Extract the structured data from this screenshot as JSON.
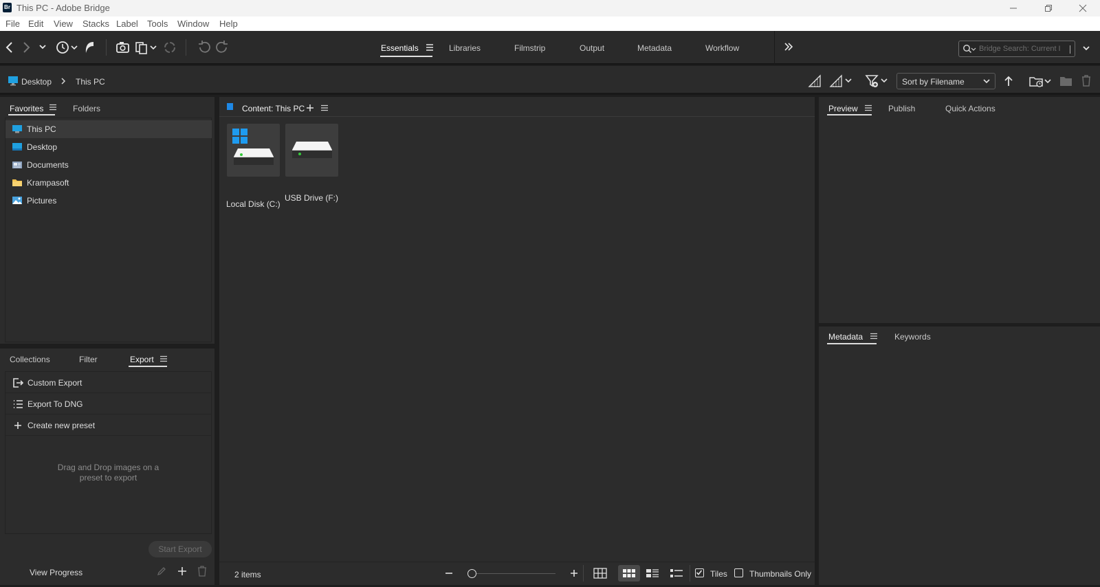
{
  "window": {
    "title": "This PC - Adobe Bridge",
    "app_badge": "Br",
    "controls": [
      "minimize-icon",
      "restore-icon",
      "close-icon"
    ]
  },
  "menu": [
    "File",
    "Edit",
    "View",
    "Stacks",
    "Label",
    "Tools",
    "Window",
    "Help"
  ],
  "workspaces": {
    "tabs": [
      "Essentials",
      "Libraries",
      "Filmstrip",
      "Output",
      "Metadata",
      "Workflow"
    ],
    "active": "Essentials",
    "overflow_icon": "double-chevron-right-icon"
  },
  "search": {
    "placeholder": "Bridge Search: Current I"
  },
  "pathbar": {
    "crumbs": [
      "Desktop",
      "This PC"
    ],
    "sort_label": "Sort by Filename"
  },
  "left_top": {
    "tabs": [
      "Favorites",
      "Folders"
    ],
    "active": "Favorites",
    "items": [
      {
        "label": "This PC",
        "icon": "monitor-icon",
        "selected": true
      },
      {
        "label": "Desktop",
        "icon": "desktop-icon",
        "selected": false
      },
      {
        "label": "Documents",
        "icon": "documents-icon",
        "selected": false
      },
      {
        "label": "Krampasoft",
        "icon": "folder-icon",
        "selected": false
      },
      {
        "label": "Pictures",
        "icon": "pictures-icon",
        "selected": false
      }
    ]
  },
  "left_bottom": {
    "tabs": [
      "Collections",
      "Filter",
      "Export"
    ],
    "active": "Export",
    "items": [
      {
        "label": "Custom Export",
        "icon": "export-icon"
      },
      {
        "label": "Export To DNG",
        "icon": "list-icon"
      },
      {
        "label": "Create new preset",
        "icon": "plus-icon"
      }
    ],
    "drop_hint": [
      "Drag and Drop images on a",
      "preset to export"
    ],
    "start_export": "Start Export",
    "view_progress": "View Progress"
  },
  "content": {
    "title": "Content: This PC",
    "items": [
      {
        "label": "Local Disk (C:)",
        "icon": "system-drive-icon"
      },
      {
        "label": "USB Drive (F:)",
        "icon": "drive-icon"
      }
    ],
    "count": "2 items",
    "tiles_label": "Tiles",
    "tiles_checked": true,
    "thumbs_only_label": "Thumbnails Only",
    "thumbs_only_checked": false
  },
  "right_top": {
    "tabs": [
      "Preview",
      "Publish",
      "Quick Actions"
    ],
    "active": "Preview"
  },
  "right_bottom": {
    "tabs": [
      "Metadata",
      "Keywords"
    ],
    "active": "Metadata"
  },
  "colors": {
    "accent_blue": "#1e88e5",
    "panel_bg": "#2c2c2c",
    "toolbar_bg": "#2a2a2a"
  }
}
